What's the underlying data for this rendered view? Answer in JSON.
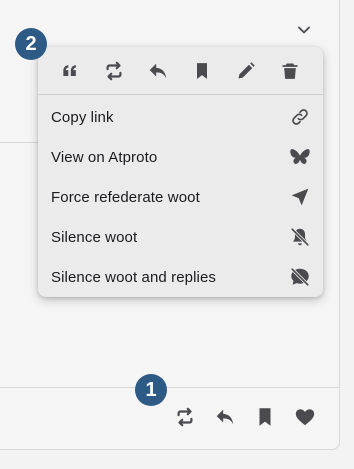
{
  "badges": {
    "top": "2",
    "bottom": "1"
  },
  "icons": {
    "chevron": "chevron-down-icon",
    "menu_actions": [
      "quote-icon",
      "boost-icon",
      "reply-icon",
      "bookmark-icon",
      "edit-icon",
      "delete-icon"
    ],
    "toolbar": [
      "boost-icon",
      "reply-icon",
      "bookmark-icon",
      "heart-icon"
    ]
  },
  "menu": {
    "items": [
      {
        "label": "Copy link",
        "icon": "link-icon"
      },
      {
        "label": "View on Atproto",
        "icon": "butterfly-icon"
      },
      {
        "label": "Force refederate woot",
        "icon": "send-icon"
      },
      {
        "label": "Silence woot",
        "icon": "bell-off-icon"
      },
      {
        "label": "Silence woot and replies",
        "icon": "comment-off-icon"
      }
    ]
  },
  "colors": {
    "badge": "#2d5b86",
    "icon": "#4a4a4f",
    "menu_background": "#ebebec",
    "page_background": "#f5f5f6"
  }
}
